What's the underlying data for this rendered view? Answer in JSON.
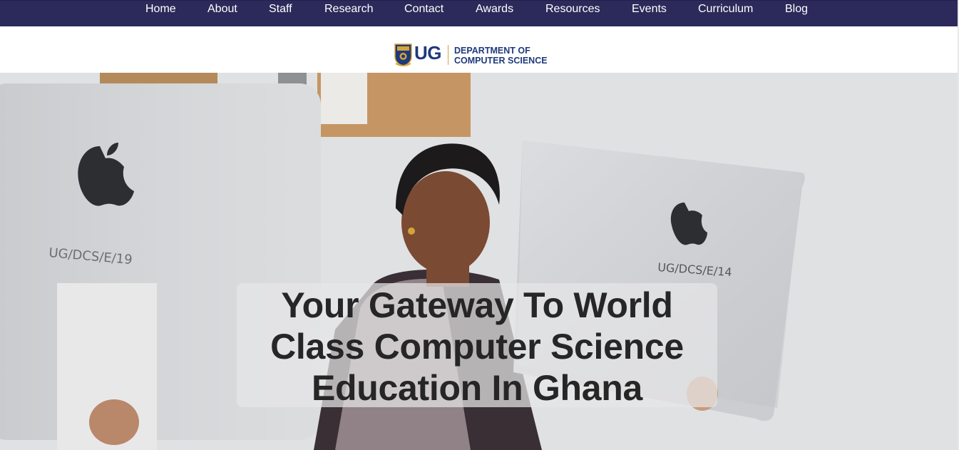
{
  "nav": {
    "items": [
      {
        "label": "Home"
      },
      {
        "label": "About"
      },
      {
        "label": "Staff"
      },
      {
        "label": "Research"
      },
      {
        "label": "Contact"
      },
      {
        "label": "Awards"
      },
      {
        "label": "Resources"
      },
      {
        "label": "Events"
      },
      {
        "label": "Curriculum"
      },
      {
        "label": "Blog"
      }
    ]
  },
  "logo": {
    "abbr": "UG",
    "dept_line1": "DEPARTMENT OF",
    "dept_line2": "COMPUTER SCIENCE"
  },
  "hero": {
    "headline": "Your Gateway To World Class Computer Science Education In Ghana",
    "monitor_left_label": "UG/DCS/E/19",
    "monitor_right_label": "UG/DCS/E/14"
  },
  "colors": {
    "nav_background": "#2c2a5a",
    "brand_blue": "#1f3a7a",
    "brand_gold": "#d4a43a"
  }
}
